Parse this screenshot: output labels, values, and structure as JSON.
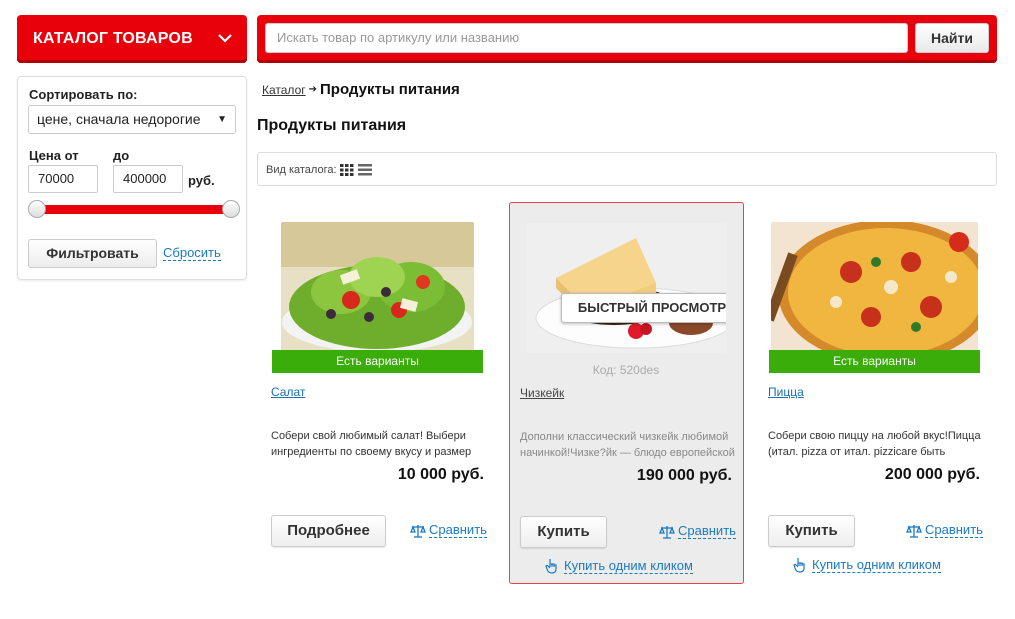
{
  "header": {
    "catalog_label": "КАТАЛОГ ТОВАРОВ",
    "search_placeholder": "Искать товар по артикулу или названию",
    "search_button": "Найти",
    "accent_color": "#e8000b"
  },
  "filter": {
    "sort_label": "Сортировать по:",
    "sort_value": "цене, сначала недорогие",
    "price_from_label": "Цена от",
    "price_to_label": "до",
    "price_from": "70000",
    "price_to": "400000",
    "currency": "руб.",
    "filter_button": "Фильтровать",
    "reset_link": "Сбросить"
  },
  "breadcrumb": {
    "root": "Каталог",
    "current": "Продукты питания"
  },
  "page_title": "Продукты питания",
  "view_bar": {
    "label": "Вид каталога:",
    "icons": [
      "grid-icon",
      "list-icon"
    ]
  },
  "products": [
    {
      "name": "Салат",
      "variants_label": "Есть варианты",
      "description": "Собери свой любимый салат! Выбери ингредиенты по своему вкусу и размер",
      "price": "10 000 руб.",
      "primary_button": "Подробнее",
      "compare_label": "Сравнить"
    },
    {
      "name": "Чизкейк",
      "code": "Код: 520des",
      "quick_view": "БЫСТРЫЙ ПРОСМОТР",
      "description": "Дополни классический чизкейк любимой начинкой!Чизке?йк — блюдо европейской",
      "price": "190 000 руб.",
      "primary_button": "Купить",
      "compare_label": "Сравнить",
      "one_click": "Купить одним кликом"
    },
    {
      "name": "Пицца",
      "variants_label": "Есть варианты",
      "description": "Собери свою пиццу на любой вкус!Пицца (итал. pizza от итал. pizzicare быть",
      "price": "200 000 руб.",
      "primary_button": "Купить",
      "compare_label": "Сравнить",
      "one_click": "Купить одним кликом"
    }
  ]
}
